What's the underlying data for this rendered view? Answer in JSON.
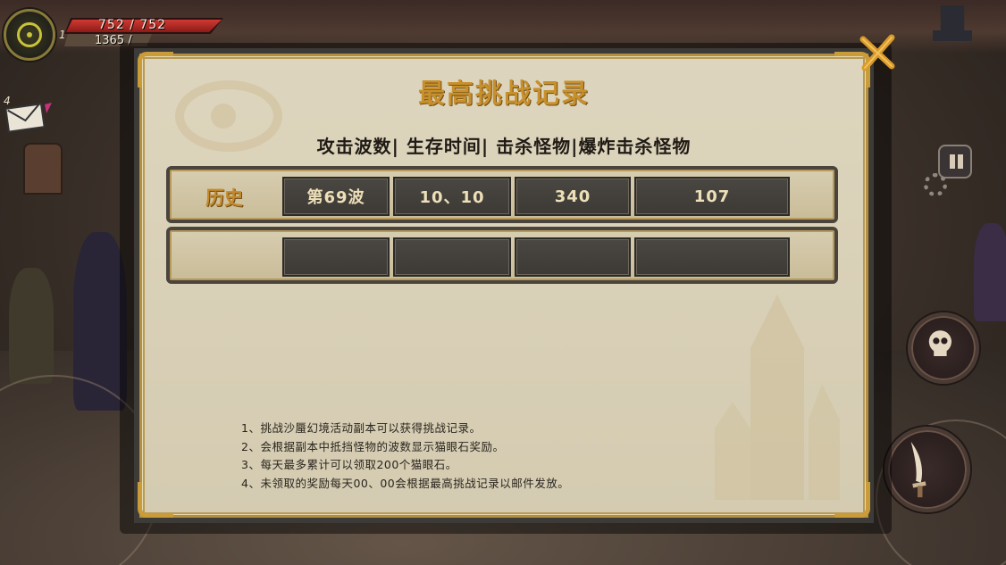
{
  "hud": {
    "level": "1",
    "hp_text": "752 / 752",
    "xp_text": "1365 /",
    "mail_count": "4"
  },
  "dialog": {
    "title": "最高挑战记录",
    "columns": [
      "攻击波数",
      "生存时间",
      "击杀怪物",
      "爆炸击杀怪物"
    ],
    "separator": "|",
    "rows": [
      {
        "label": "历史",
        "values": [
          "第69波",
          "10、10",
          "340",
          "107"
        ]
      },
      {
        "label": "",
        "values": [
          "",
          "",
          "",
          ""
        ]
      }
    ],
    "notes": [
      "1、挑战沙蜃幻境活动副本可以获得挑战记录。",
      "2、会根据副本中抵挡怪物的波数显示猫眼石奖励。",
      "3、每天最多累计可以领取200个猫眼石。",
      "4、未领取的奖励每天00、00会根据最高挑战记录以邮件发放。"
    ]
  },
  "colors": {
    "title": "#c8902c",
    "panel_bg": "#d8d0b6",
    "cell_bg": "#43403c",
    "cell_text": "#ede0b8",
    "hp_fill": "#c0302a",
    "close_x": "#d99a2a"
  },
  "icons": [
    "player-avatar-icon",
    "mail-icon",
    "close-icon",
    "pause-icon",
    "gear-icon",
    "skull-skill-icon",
    "dagger-attack-icon",
    "eye-watermark-icon",
    "spire-watermark-icon"
  ]
}
